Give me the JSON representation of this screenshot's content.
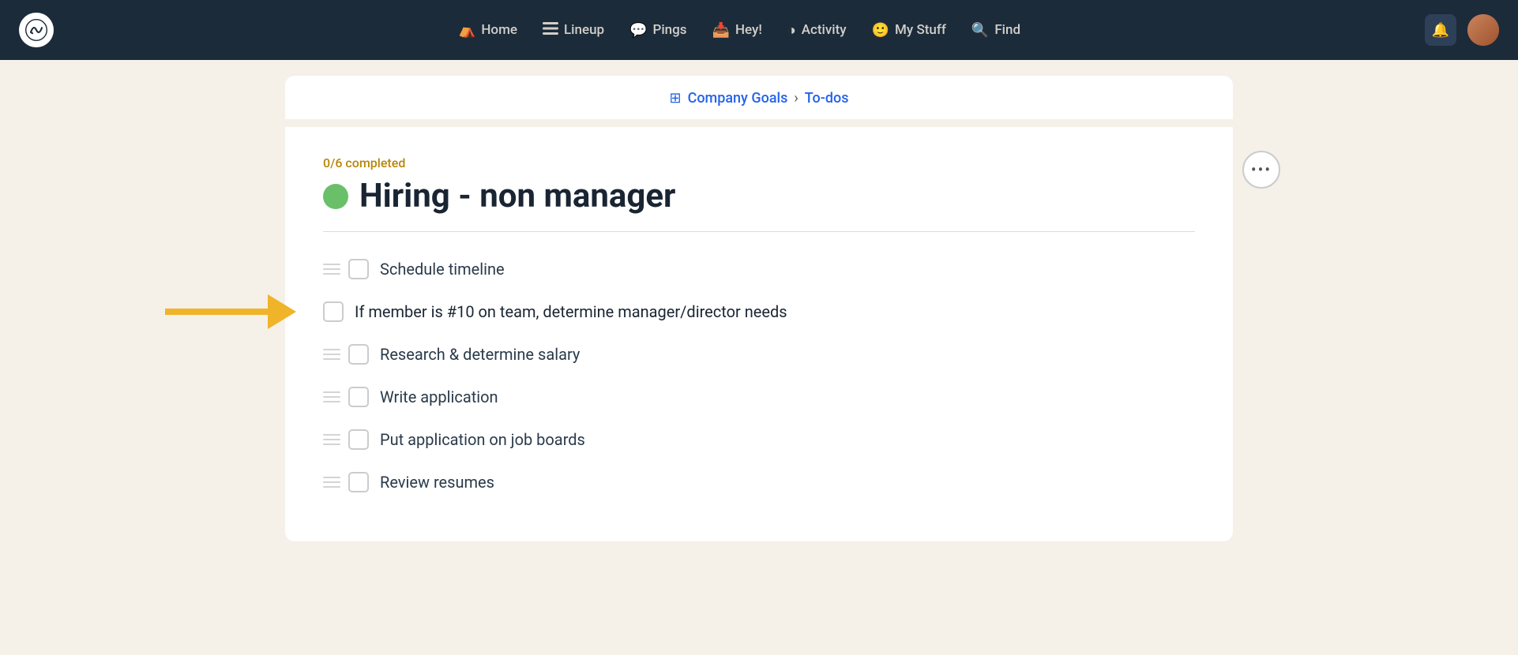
{
  "nav": {
    "logo_alt": "Basecamp logo",
    "links": [
      {
        "id": "home",
        "label": "Home",
        "icon": "⛺"
      },
      {
        "id": "lineup",
        "label": "Lineup",
        "icon": "☰"
      },
      {
        "id": "pings",
        "label": "Pings",
        "icon": "💬"
      },
      {
        "id": "hey",
        "label": "Hey!",
        "icon": "📥"
      },
      {
        "id": "activity",
        "label": "Activity",
        "icon": "◑"
      },
      {
        "id": "mystuff",
        "label": "My Stuff",
        "icon": "🙂"
      },
      {
        "id": "find",
        "label": "Find",
        "icon": "🔍"
      }
    ],
    "notif_icon": "🔔",
    "avatar_alt": "User avatar"
  },
  "breadcrumb": {
    "icon": "⊞",
    "parent_label": "Company Goals",
    "separator": "›",
    "current_label": "To-dos"
  },
  "goal": {
    "completed_label": "0/6 completed",
    "title": "Hiring - non manager",
    "dot_color": "#6abf69"
  },
  "todos": [
    {
      "id": 1,
      "text": "Schedule timeline",
      "checked": false,
      "has_arrow": false
    },
    {
      "id": 2,
      "text": "If member is #10 on team, determine manager/director needs",
      "checked": false,
      "has_arrow": true
    },
    {
      "id": 3,
      "text": "Research & determine salary",
      "checked": false,
      "has_arrow": false
    },
    {
      "id": 4,
      "text": "Write application",
      "checked": false,
      "has_arrow": false
    },
    {
      "id": 5,
      "text": "Put application on job boards",
      "checked": false,
      "has_arrow": false
    },
    {
      "id": 6,
      "text": "Review resumes",
      "checked": false,
      "has_arrow": false
    }
  ],
  "more_options_label": "•••"
}
